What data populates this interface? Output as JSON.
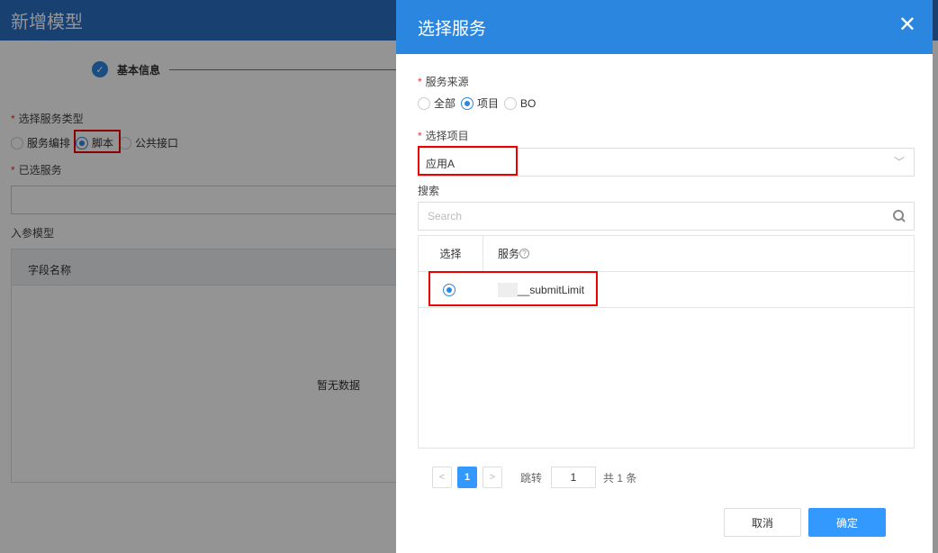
{
  "background": {
    "title": "新增模型",
    "step": "基本信息",
    "service_type_label": "选择服务类型",
    "service_type_options": [
      "服务编排",
      "脚本",
      "公共接口"
    ],
    "selected_service_label": "已选服务",
    "input_model_label": "入参模型",
    "table_header": "字段名称",
    "empty_text": "暂无数据"
  },
  "dialog": {
    "title": "选择服务",
    "source_label": "服务来源",
    "source_options": [
      "全部",
      "项目",
      "BO"
    ],
    "project_label": "选择项目",
    "project_value": "应用A",
    "search_label": "搜索",
    "search_placeholder": "Search",
    "table": {
      "col_select": "选择",
      "col_service": "服务",
      "rows": [
        {
          "service": "__submitLimit",
          "selected": true
        }
      ]
    },
    "pager": {
      "prev": "<",
      "page": "1",
      "next": ">",
      "jump_label": "跳转",
      "jump_value": "1",
      "total": "共 1 条"
    },
    "cancel": "取消",
    "confirm": "确定"
  }
}
